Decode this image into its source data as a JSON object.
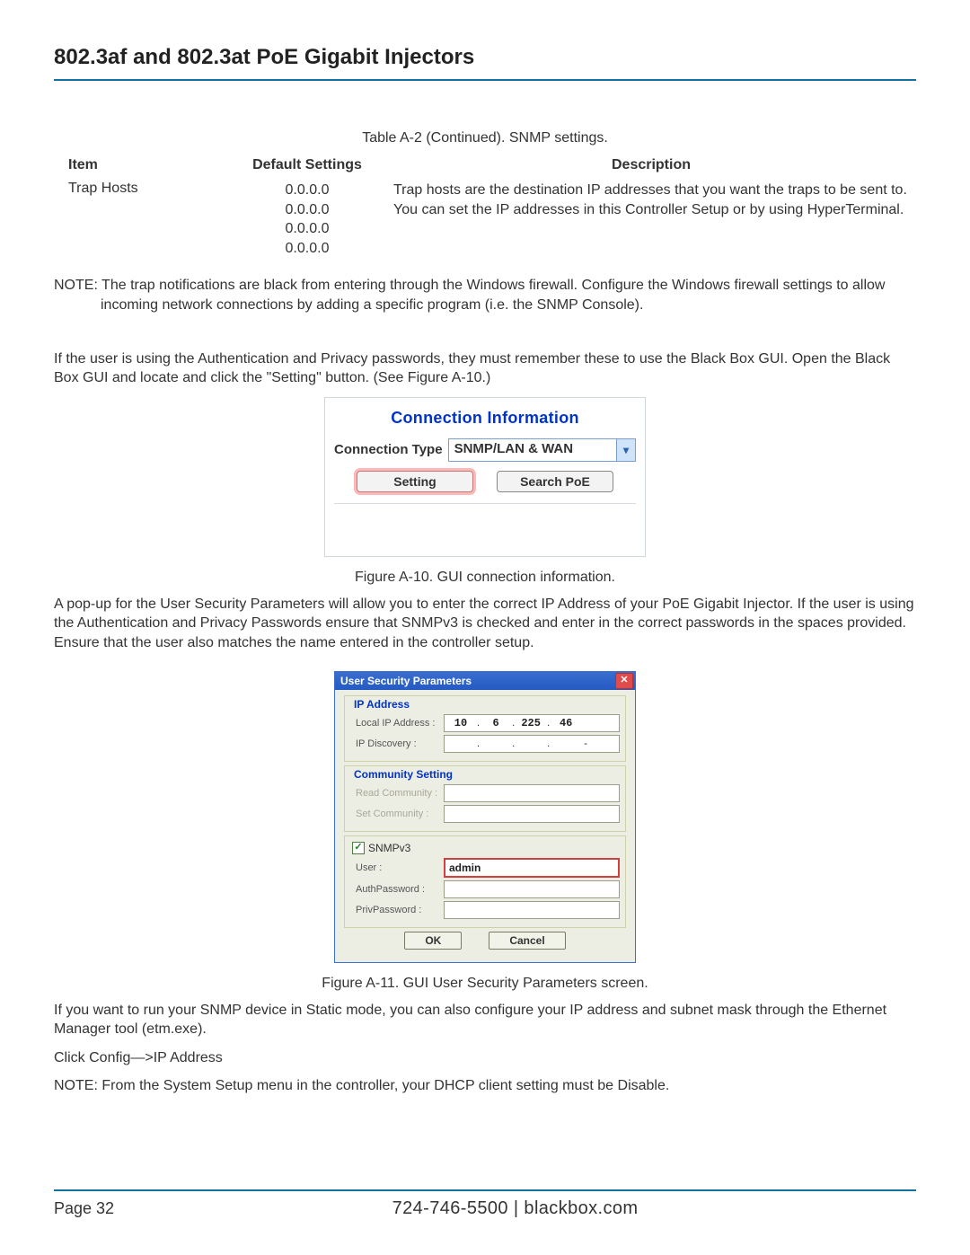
{
  "header": "802.3af and 802.3at PoE Gigabit Injectors",
  "table": {
    "caption": "Table A-2 (Continued). SNMP settings.",
    "headers": {
      "item": "Item",
      "def": "Default Settings",
      "desc": "Description"
    },
    "row": {
      "item": "Trap Hosts",
      "def": "0.0.0.0\n0.0.0.0\n0.0.0.0\n0.0.0.0",
      "desc": "Trap hosts are the destination IP addresses that you want the traps to be sent to. You can set the IP addresses in this Controller Setup or by using HyperTerminal."
    },
    "note": "NOTE: The trap notifications are black from entering through the Windows firewall. Configure the Windows firewall settings to allow incoming network connections by adding a specific program (i.e. the SNMP Console)."
  },
  "para1": "If the user is using the Authentication and Privacy passwords, they must remember these to use the Black Box GUI. Open the Black Box GUI and locate and click the \"Setting\" button. (See Figure A-10.)",
  "fig10": {
    "title": "Connection Information",
    "label": "Connection Type",
    "select_value": "SNMP/LAN & WAN",
    "btn_setting": "Setting",
    "btn_search": "Search PoE",
    "caption": "Figure A-10. GUI connection information."
  },
  "para2": "A pop-up for the User Security Parameters will allow you to enter the correct IP Address of your PoE Gigabit Injector. If the user is using the Authentication and Privacy Passwords ensure that SNMPv3 is checked and enter in the correct passwords in the spaces provided. Ensure that the user also matches the name entered in the controller setup.",
  "fig11": {
    "title": "User Security Parameters",
    "sections": {
      "ip": "IP Address",
      "comm": "Community Setting"
    },
    "labels": {
      "local_ip": "Local IP Address :",
      "ip_disc": "IP Discovery :",
      "read_comm": "Read Community :",
      "set_comm": "Set Community :",
      "snmpv3": "SNMPv3",
      "user": "User :",
      "auth": "AuthPassword :",
      "priv": "PrivPassword :"
    },
    "values": {
      "ip_oct1": "10",
      "ip_oct2": "6",
      "ip_oct3": "225",
      "ip_oct4": "46",
      "user": "admin"
    },
    "btn_ok": "OK",
    "btn_cancel": "Cancel",
    "caption": "Figure A-11. GUI User Security Parameters screen."
  },
  "para3": "If you want to run your SNMP device in Static mode, you can also configure your IP address and subnet mask through the Ethernet Manager tool (etm.exe).",
  "para4": "Click Config—>IP Address",
  "para5": "NOTE: From the System Setup menu in the controller, your DHCP client setting must be Disable.",
  "footer": {
    "page": "Page 32",
    "contact": "724-746-5500   |   blackbox.com"
  }
}
